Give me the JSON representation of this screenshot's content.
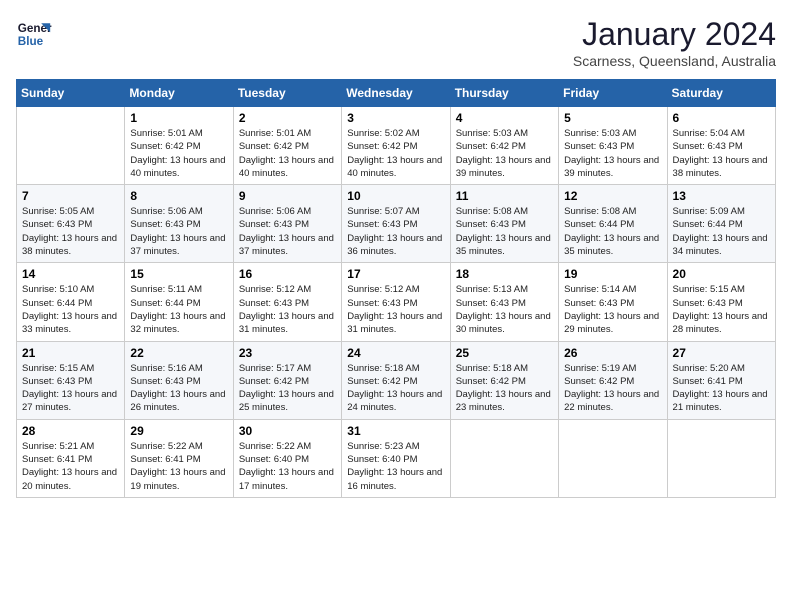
{
  "header": {
    "logo_line1": "General",
    "logo_line2": "Blue",
    "month_year": "January 2024",
    "location": "Scarness, Queensland, Australia"
  },
  "weekdays": [
    "Sunday",
    "Monday",
    "Tuesday",
    "Wednesday",
    "Thursday",
    "Friday",
    "Saturday"
  ],
  "weeks": [
    [
      {
        "day": "",
        "sunrise": "",
        "sunset": "",
        "daylight": ""
      },
      {
        "day": "1",
        "sunrise": "Sunrise: 5:01 AM",
        "sunset": "Sunset: 6:42 PM",
        "daylight": "Daylight: 13 hours and 40 minutes."
      },
      {
        "day": "2",
        "sunrise": "Sunrise: 5:01 AM",
        "sunset": "Sunset: 6:42 PM",
        "daylight": "Daylight: 13 hours and 40 minutes."
      },
      {
        "day": "3",
        "sunrise": "Sunrise: 5:02 AM",
        "sunset": "Sunset: 6:42 PM",
        "daylight": "Daylight: 13 hours and 40 minutes."
      },
      {
        "day": "4",
        "sunrise": "Sunrise: 5:03 AM",
        "sunset": "Sunset: 6:42 PM",
        "daylight": "Daylight: 13 hours and 39 minutes."
      },
      {
        "day": "5",
        "sunrise": "Sunrise: 5:03 AM",
        "sunset": "Sunset: 6:43 PM",
        "daylight": "Daylight: 13 hours and 39 minutes."
      },
      {
        "day": "6",
        "sunrise": "Sunrise: 5:04 AM",
        "sunset": "Sunset: 6:43 PM",
        "daylight": "Daylight: 13 hours and 38 minutes."
      }
    ],
    [
      {
        "day": "7",
        "sunrise": "Sunrise: 5:05 AM",
        "sunset": "Sunset: 6:43 PM",
        "daylight": "Daylight: 13 hours and 38 minutes."
      },
      {
        "day": "8",
        "sunrise": "Sunrise: 5:06 AM",
        "sunset": "Sunset: 6:43 PM",
        "daylight": "Daylight: 13 hours and 37 minutes."
      },
      {
        "day": "9",
        "sunrise": "Sunrise: 5:06 AM",
        "sunset": "Sunset: 6:43 PM",
        "daylight": "Daylight: 13 hours and 37 minutes."
      },
      {
        "day": "10",
        "sunrise": "Sunrise: 5:07 AM",
        "sunset": "Sunset: 6:43 PM",
        "daylight": "Daylight: 13 hours and 36 minutes."
      },
      {
        "day": "11",
        "sunrise": "Sunrise: 5:08 AM",
        "sunset": "Sunset: 6:43 PM",
        "daylight": "Daylight: 13 hours and 35 minutes."
      },
      {
        "day": "12",
        "sunrise": "Sunrise: 5:08 AM",
        "sunset": "Sunset: 6:44 PM",
        "daylight": "Daylight: 13 hours and 35 minutes."
      },
      {
        "day": "13",
        "sunrise": "Sunrise: 5:09 AM",
        "sunset": "Sunset: 6:44 PM",
        "daylight": "Daylight: 13 hours and 34 minutes."
      }
    ],
    [
      {
        "day": "14",
        "sunrise": "Sunrise: 5:10 AM",
        "sunset": "Sunset: 6:44 PM",
        "daylight": "Daylight: 13 hours and 33 minutes."
      },
      {
        "day": "15",
        "sunrise": "Sunrise: 5:11 AM",
        "sunset": "Sunset: 6:44 PM",
        "daylight": "Daylight: 13 hours and 32 minutes."
      },
      {
        "day": "16",
        "sunrise": "Sunrise: 5:12 AM",
        "sunset": "Sunset: 6:43 PM",
        "daylight": "Daylight: 13 hours and 31 minutes."
      },
      {
        "day": "17",
        "sunrise": "Sunrise: 5:12 AM",
        "sunset": "Sunset: 6:43 PM",
        "daylight": "Daylight: 13 hours and 31 minutes."
      },
      {
        "day": "18",
        "sunrise": "Sunrise: 5:13 AM",
        "sunset": "Sunset: 6:43 PM",
        "daylight": "Daylight: 13 hours and 30 minutes."
      },
      {
        "day": "19",
        "sunrise": "Sunrise: 5:14 AM",
        "sunset": "Sunset: 6:43 PM",
        "daylight": "Daylight: 13 hours and 29 minutes."
      },
      {
        "day": "20",
        "sunrise": "Sunrise: 5:15 AM",
        "sunset": "Sunset: 6:43 PM",
        "daylight": "Daylight: 13 hours and 28 minutes."
      }
    ],
    [
      {
        "day": "21",
        "sunrise": "Sunrise: 5:15 AM",
        "sunset": "Sunset: 6:43 PM",
        "daylight": "Daylight: 13 hours and 27 minutes."
      },
      {
        "day": "22",
        "sunrise": "Sunrise: 5:16 AM",
        "sunset": "Sunset: 6:43 PM",
        "daylight": "Daylight: 13 hours and 26 minutes."
      },
      {
        "day": "23",
        "sunrise": "Sunrise: 5:17 AM",
        "sunset": "Sunset: 6:42 PM",
        "daylight": "Daylight: 13 hours and 25 minutes."
      },
      {
        "day": "24",
        "sunrise": "Sunrise: 5:18 AM",
        "sunset": "Sunset: 6:42 PM",
        "daylight": "Daylight: 13 hours and 24 minutes."
      },
      {
        "day": "25",
        "sunrise": "Sunrise: 5:18 AM",
        "sunset": "Sunset: 6:42 PM",
        "daylight": "Daylight: 13 hours and 23 minutes."
      },
      {
        "day": "26",
        "sunrise": "Sunrise: 5:19 AM",
        "sunset": "Sunset: 6:42 PM",
        "daylight": "Daylight: 13 hours and 22 minutes."
      },
      {
        "day": "27",
        "sunrise": "Sunrise: 5:20 AM",
        "sunset": "Sunset: 6:41 PM",
        "daylight": "Daylight: 13 hours and 21 minutes."
      }
    ],
    [
      {
        "day": "28",
        "sunrise": "Sunrise: 5:21 AM",
        "sunset": "Sunset: 6:41 PM",
        "daylight": "Daylight: 13 hours and 20 minutes."
      },
      {
        "day": "29",
        "sunrise": "Sunrise: 5:22 AM",
        "sunset": "Sunset: 6:41 PM",
        "daylight": "Daylight: 13 hours and 19 minutes."
      },
      {
        "day": "30",
        "sunrise": "Sunrise: 5:22 AM",
        "sunset": "Sunset: 6:40 PM",
        "daylight": "Daylight: 13 hours and 17 minutes."
      },
      {
        "day": "31",
        "sunrise": "Sunrise: 5:23 AM",
        "sunset": "Sunset: 6:40 PM",
        "daylight": "Daylight: 13 hours and 16 minutes."
      },
      {
        "day": "",
        "sunrise": "",
        "sunset": "",
        "daylight": ""
      },
      {
        "day": "",
        "sunrise": "",
        "sunset": "",
        "daylight": ""
      },
      {
        "day": "",
        "sunrise": "",
        "sunset": "",
        "daylight": ""
      }
    ]
  ]
}
